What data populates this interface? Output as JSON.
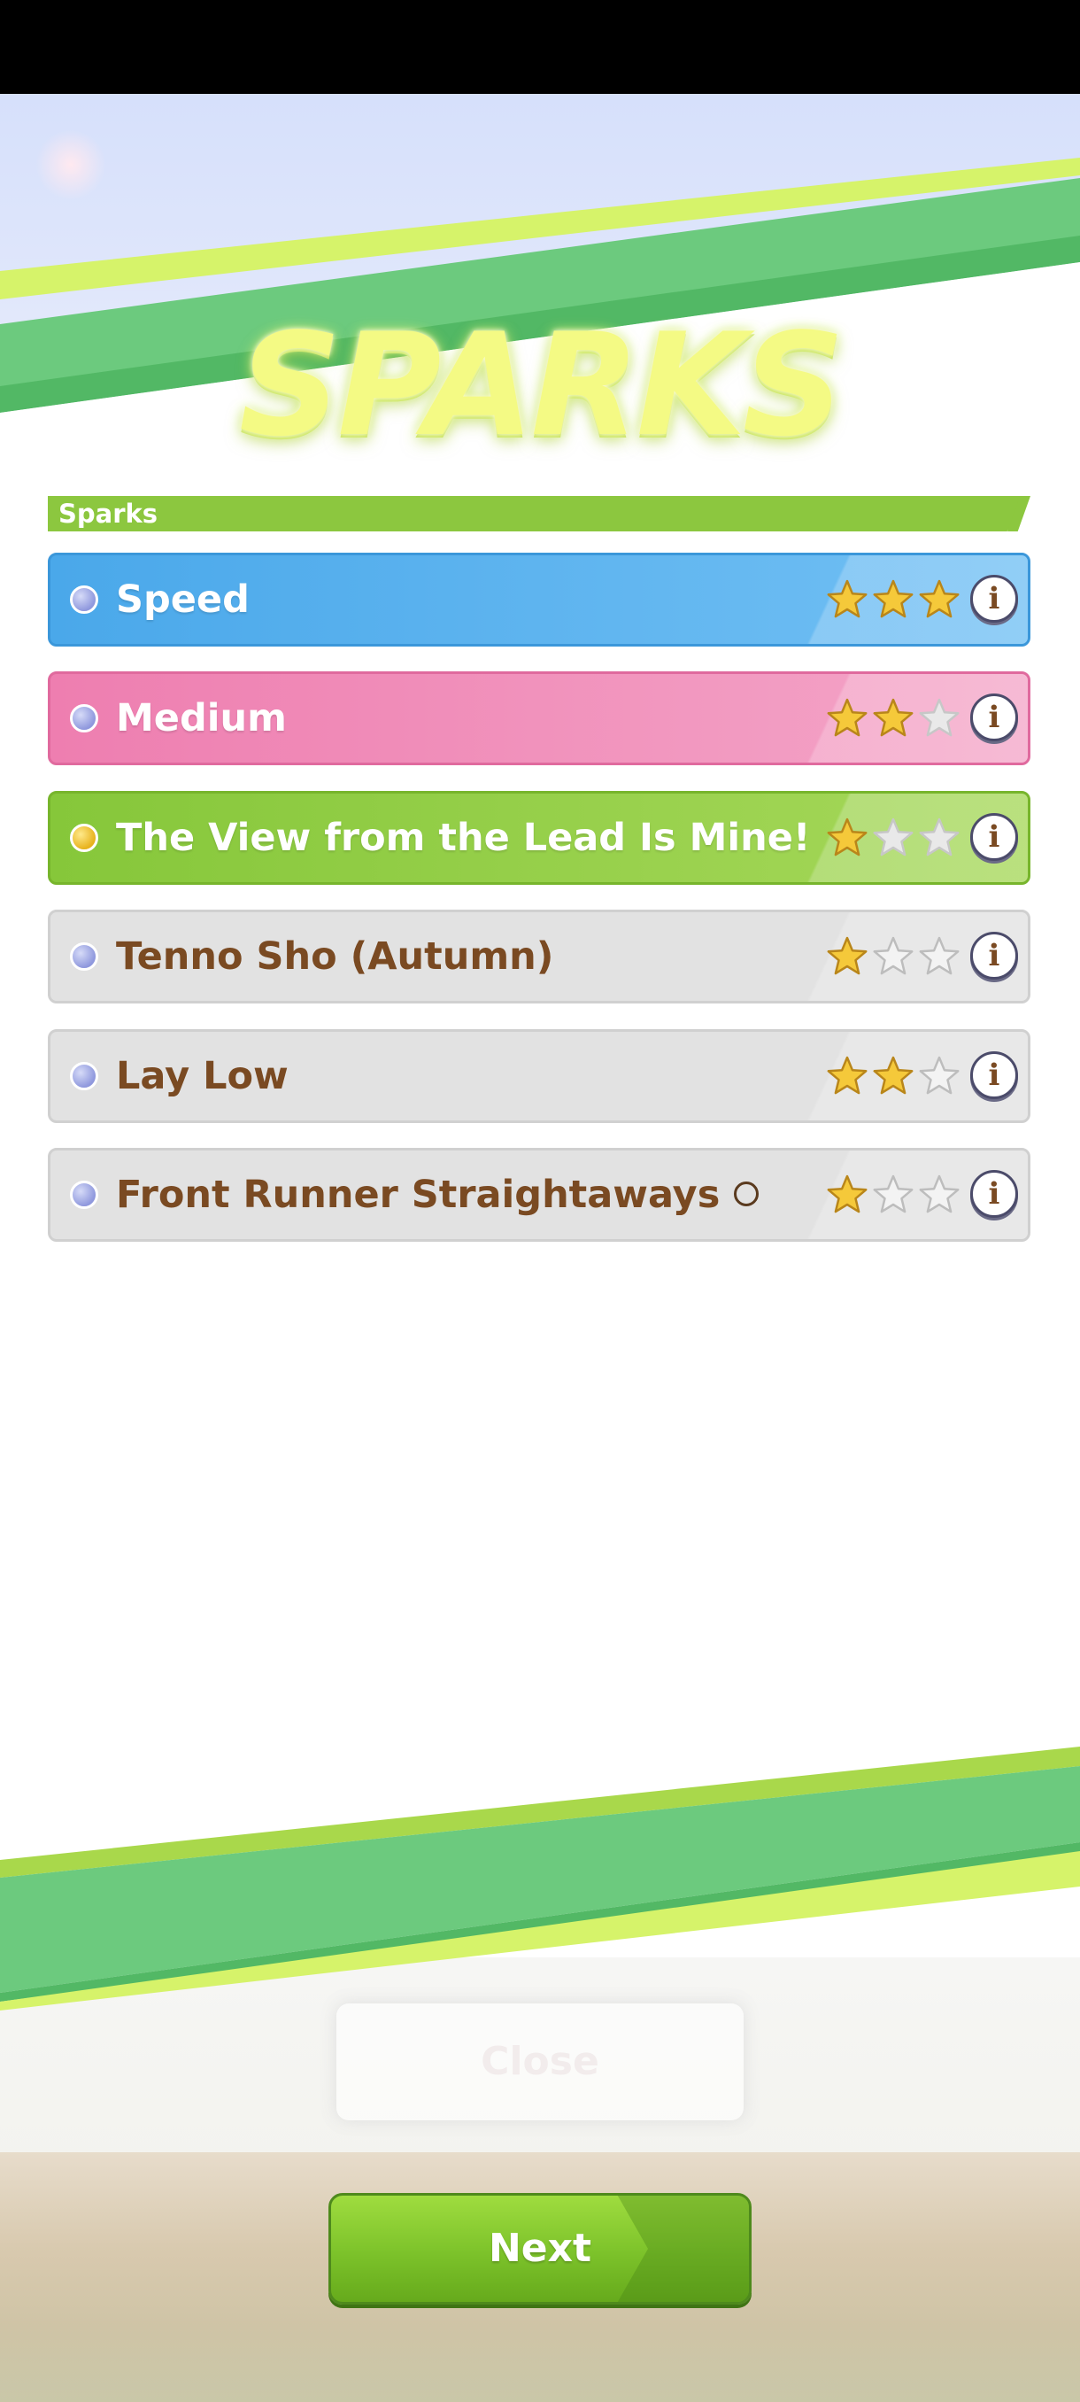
{
  "screen": {
    "title": "SPARKS",
    "section_label": "Sparks"
  },
  "sparks": [
    {
      "name": "Speed",
      "stars": 3,
      "color": "#4aa8ea",
      "dot": "blue"
    },
    {
      "name": "Medium",
      "stars": 2,
      "color": "#ee7eb0",
      "dot": "blue"
    },
    {
      "name": "The View from the Lead Is Mine!",
      "stars": 1,
      "color": "#86c73a",
      "dot": "gold"
    },
    {
      "name": "Tenno Sho (Autumn)",
      "stars": 1,
      "color": "#e2e2e2",
      "dot": "blue"
    },
    {
      "name": "Lay Low",
      "stars": 2,
      "color": "#e2e2e2",
      "dot": "blue"
    },
    {
      "name": "Front Runner Straightaways",
      "stars": 1,
      "color": "#e2e2e2",
      "dot": "blue",
      "suffix_icon": "circle-icon"
    }
  ],
  "info_icon": "i",
  "buttons": {
    "close": "Close",
    "next": "Next"
  },
  "colors": {
    "accent_green": "#8cc73f",
    "star_gold": "#f5c93a",
    "text_brown": "#7a4a22"
  }
}
